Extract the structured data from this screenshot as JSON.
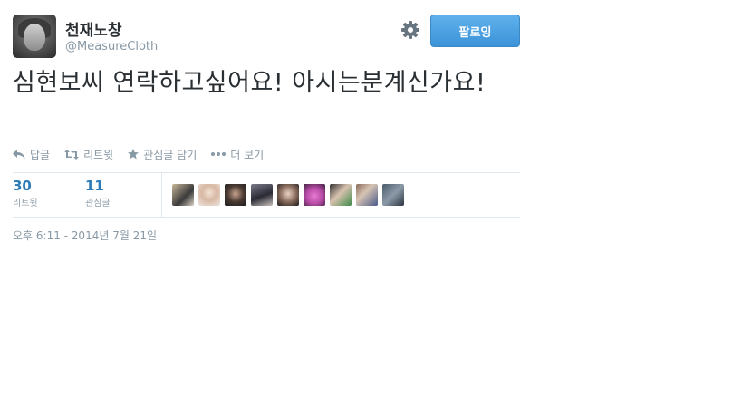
{
  "user": {
    "fullname": "천재노창",
    "username": "@MeasureCloth"
  },
  "header": {
    "settings_icon": "gear-icon",
    "follow_label": "팔로잉"
  },
  "tweet": {
    "text": "심현보씨 연락하고싶어요! 아시는분계신가요!"
  },
  "actions": {
    "reply_label": "답글",
    "retweet_label": "리트윗",
    "favorite_label": "관심글 담기",
    "more_label": "더 보기"
  },
  "stats": {
    "retweets": {
      "count": "30",
      "label": "리트윗"
    },
    "favorites": {
      "count": "11",
      "label": "관심글"
    }
  },
  "timestamp": "오후 6:11 - 2014년 7월 21일",
  "colors": {
    "accent": "#55acee",
    "link_blue": "#2b7bb9",
    "muted_text": "#8899a6"
  }
}
